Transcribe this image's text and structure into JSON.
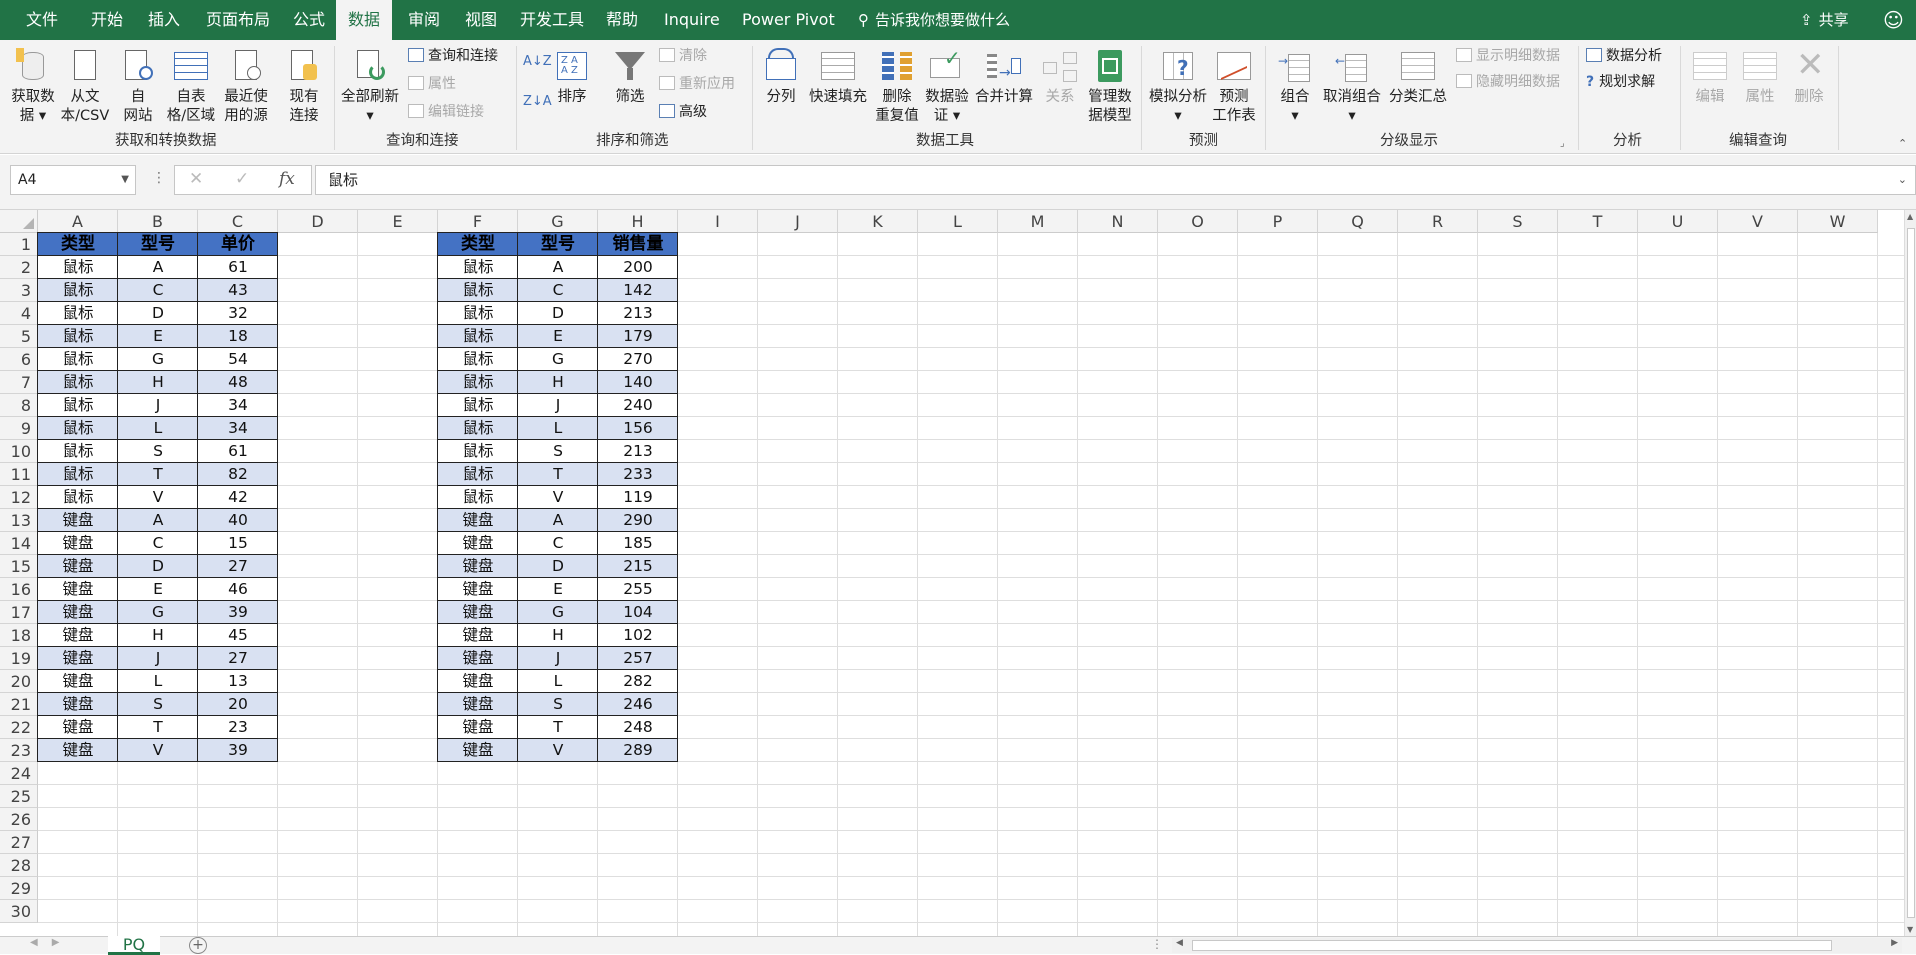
{
  "menu": {
    "tabs": [
      "文件",
      "开始",
      "插入",
      "页面布局",
      "公式",
      "数据",
      "审阅",
      "视图",
      "开发工具",
      "帮助",
      "Inquire",
      "Power Pivot"
    ],
    "active": "数据",
    "tell_me": "告诉我你想要做什么",
    "share": "共享",
    "smiley": "☺"
  },
  "ribbon": {
    "get_data": "获取数\n据 ▾",
    "from_csv": "从文\n本/CSV",
    "from_web": "自\n网站",
    "from_table": "自表\n格/区域",
    "recent_sources": "最近使\n用的源",
    "existing_conn": "现有\n连接",
    "group_get_transform": "获取和转换数据",
    "refresh_all": "全部刷新\n▾",
    "queries_conn": "查询和连接",
    "properties": "属性",
    "edit_links": "编辑链接",
    "group_queries": "查询和连接",
    "sort": "排序",
    "filter": "筛选",
    "clear": "清除",
    "reapply": "重新应用",
    "advanced": "高级",
    "group_sort_filter": "排序和筛选",
    "text_to_columns": "分列",
    "flash_fill": "快速填充",
    "remove_dup": "删除\n重复值",
    "data_validation": "数据验\n证 ▾",
    "consolidate": "合并计算",
    "relationships": "关系",
    "data_model": "管理数\n据模型",
    "group_data_tools": "数据工具",
    "what_if": "模拟分析\n▾",
    "forecast_sheet": "预测\n工作表",
    "group_forecast": "预测",
    "group_btn": "组合\n▾",
    "ungroup": "取消组合\n▾",
    "subtotal": "分类汇总",
    "show_detail": "显示明细数据",
    "hide_detail": "隐藏明细数据",
    "group_outline": "分级显示",
    "data_analysis": "数据分析",
    "solver": "规划求解",
    "group_analysis": "分析",
    "edit_q": "编辑",
    "props_q": "属性",
    "delete_q": "删除",
    "group_edit_query": "编辑查询"
  },
  "formula_bar": {
    "name_box": "A4",
    "fx": "fx",
    "content": "鼠标",
    "cancel": "✕",
    "enter": "✓"
  },
  "columns": [
    "A",
    "B",
    "C",
    "D",
    "E",
    "F",
    "G",
    "H",
    "I",
    "J",
    "K",
    "L",
    "M",
    "N",
    "O",
    "P",
    "Q",
    "R",
    "S",
    "T",
    "U",
    "V",
    "W"
  ],
  "rows": [
    "1",
    "2",
    "3",
    "4",
    "5",
    "6",
    "7",
    "8",
    "9",
    "10",
    "11",
    "12",
    "13",
    "14",
    "15",
    "16",
    "17",
    "18",
    "19",
    "20",
    "21",
    "22",
    "23",
    "24",
    "25",
    "26",
    "27",
    "28",
    "29",
    "30"
  ],
  "table1": {
    "headers": [
      "类型",
      "型号",
      "单价"
    ],
    "rows": [
      [
        "鼠标",
        "A",
        "61"
      ],
      [
        "鼠标",
        "C",
        "43"
      ],
      [
        "鼠标",
        "D",
        "32"
      ],
      [
        "鼠标",
        "E",
        "18"
      ],
      [
        "鼠标",
        "G",
        "54"
      ],
      [
        "鼠标",
        "H",
        "48"
      ],
      [
        "鼠标",
        "J",
        "34"
      ],
      [
        "鼠标",
        "L",
        "34"
      ],
      [
        "鼠标",
        "S",
        "61"
      ],
      [
        "鼠标",
        "T",
        "82"
      ],
      [
        "鼠标",
        "V",
        "42"
      ],
      [
        "键盘",
        "A",
        "40"
      ],
      [
        "键盘",
        "C",
        "15"
      ],
      [
        "键盘",
        "D",
        "27"
      ],
      [
        "键盘",
        "E",
        "46"
      ],
      [
        "键盘",
        "G",
        "39"
      ],
      [
        "键盘",
        "H",
        "45"
      ],
      [
        "键盘",
        "J",
        "27"
      ],
      [
        "键盘",
        "L",
        "13"
      ],
      [
        "键盘",
        "S",
        "20"
      ],
      [
        "键盘",
        "T",
        "23"
      ],
      [
        "键盘",
        "V",
        "39"
      ]
    ]
  },
  "table2": {
    "headers": [
      "类型",
      "型号",
      "销售量"
    ],
    "rows": [
      [
        "鼠标",
        "A",
        "200"
      ],
      [
        "鼠标",
        "C",
        "142"
      ],
      [
        "鼠标",
        "D",
        "213"
      ],
      [
        "鼠标",
        "E",
        "179"
      ],
      [
        "鼠标",
        "G",
        "270"
      ],
      [
        "鼠标",
        "H",
        "140"
      ],
      [
        "鼠标",
        "J",
        "240"
      ],
      [
        "鼠标",
        "L",
        "156"
      ],
      [
        "鼠标",
        "S",
        "213"
      ],
      [
        "鼠标",
        "T",
        "233"
      ],
      [
        "鼠标",
        "V",
        "119"
      ],
      [
        "键盘",
        "A",
        "290"
      ],
      [
        "键盘",
        "C",
        "185"
      ],
      [
        "键盘",
        "D",
        "215"
      ],
      [
        "键盘",
        "E",
        "255"
      ],
      [
        "键盘",
        "G",
        "104"
      ],
      [
        "键盘",
        "H",
        "102"
      ],
      [
        "键盘",
        "J",
        "257"
      ],
      [
        "键盘",
        "L",
        "282"
      ],
      [
        "键盘",
        "S",
        "246"
      ],
      [
        "键盘",
        "T",
        "248"
      ],
      [
        "键盘",
        "V",
        "289"
      ]
    ]
  },
  "sheet": {
    "name": "PQ",
    "add": "+"
  },
  "colors": {
    "excel_green": "#217346",
    "table_header": "#4472c4",
    "table_band": "#d9e1f2"
  }
}
